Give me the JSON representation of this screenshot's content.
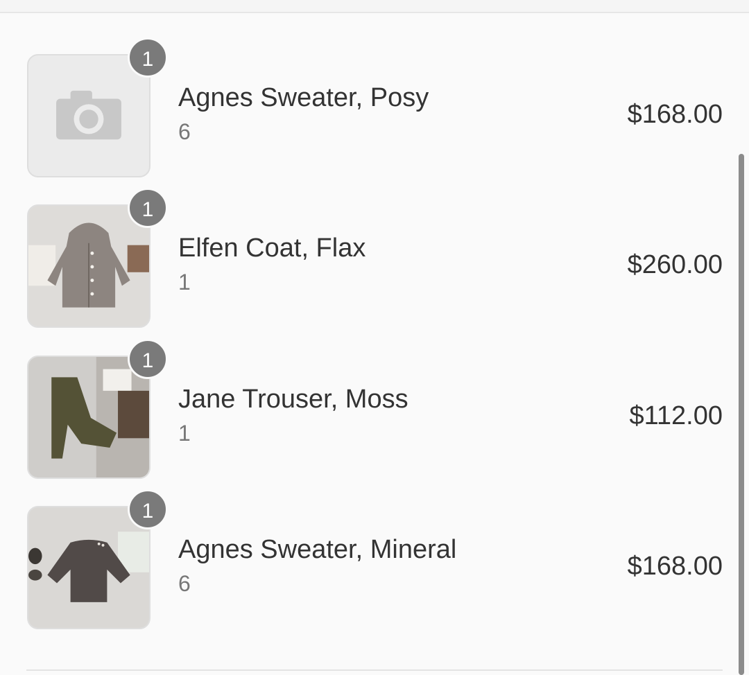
{
  "order_summary": {
    "items": [
      {
        "quantity": "1",
        "name": "Agnes Sweater, Posy",
        "variant": "6",
        "price": "$168.00",
        "image": "camera-placeholder-icon"
      },
      {
        "quantity": "1",
        "name": "Elfen Coat, Flax",
        "variant": "1",
        "price": "$260.00",
        "image": "coat-photo"
      },
      {
        "quantity": "1",
        "name": "Jane Trouser, Moss",
        "variant": "1",
        "price": "$112.00",
        "image": "trouser-photo"
      },
      {
        "quantity": "1",
        "name": "Agnes Sweater, Mineral",
        "variant": "6",
        "price": "$168.00",
        "image": "sweater-photo"
      }
    ]
  },
  "colors": {
    "background": "#fafafa",
    "badge": "#7a7a7a",
    "text": "#333333",
    "secondary_text": "#777777"
  }
}
